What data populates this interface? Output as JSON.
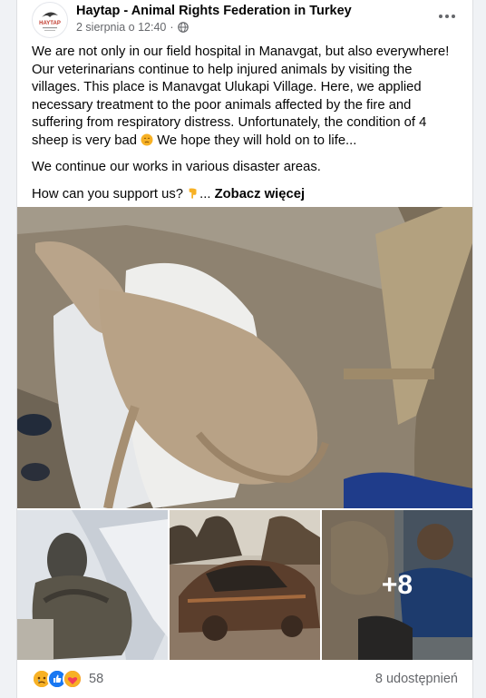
{
  "post": {
    "author": "Haytap - Animal Rights Federation in Turkey",
    "date": "2 sierpnia o 12:40",
    "paragraph1": "We are not only in our field hospital in Manavgat, but also everywhere! Our veterinarians continue to help injured animals by visiting the villages. This place is Manavgat Ulukapi Village. Here, we applied necessary treatment to the poor animals affected by the fire and suffering from respiratory distress. Unfortunately, the condition of 4 sheep is very bad",
    "paragraph1_end": " We hope they will hold on to life...",
    "paragraph2": "We continue our works in various disaster areas.",
    "paragraph3": "How can you support us?",
    "ellipsis": "...",
    "see_more": "Zobacz więcej",
    "more_photos": "+8",
    "reaction_count": "58",
    "shares": "8 udostępnień",
    "avatar_text": "HAYTAP"
  },
  "colors": {
    "meta_gray": "#65676b",
    "like_blue": "#1877f2",
    "love_red": "#f33e58",
    "sad_yellow": "#f7b125"
  }
}
